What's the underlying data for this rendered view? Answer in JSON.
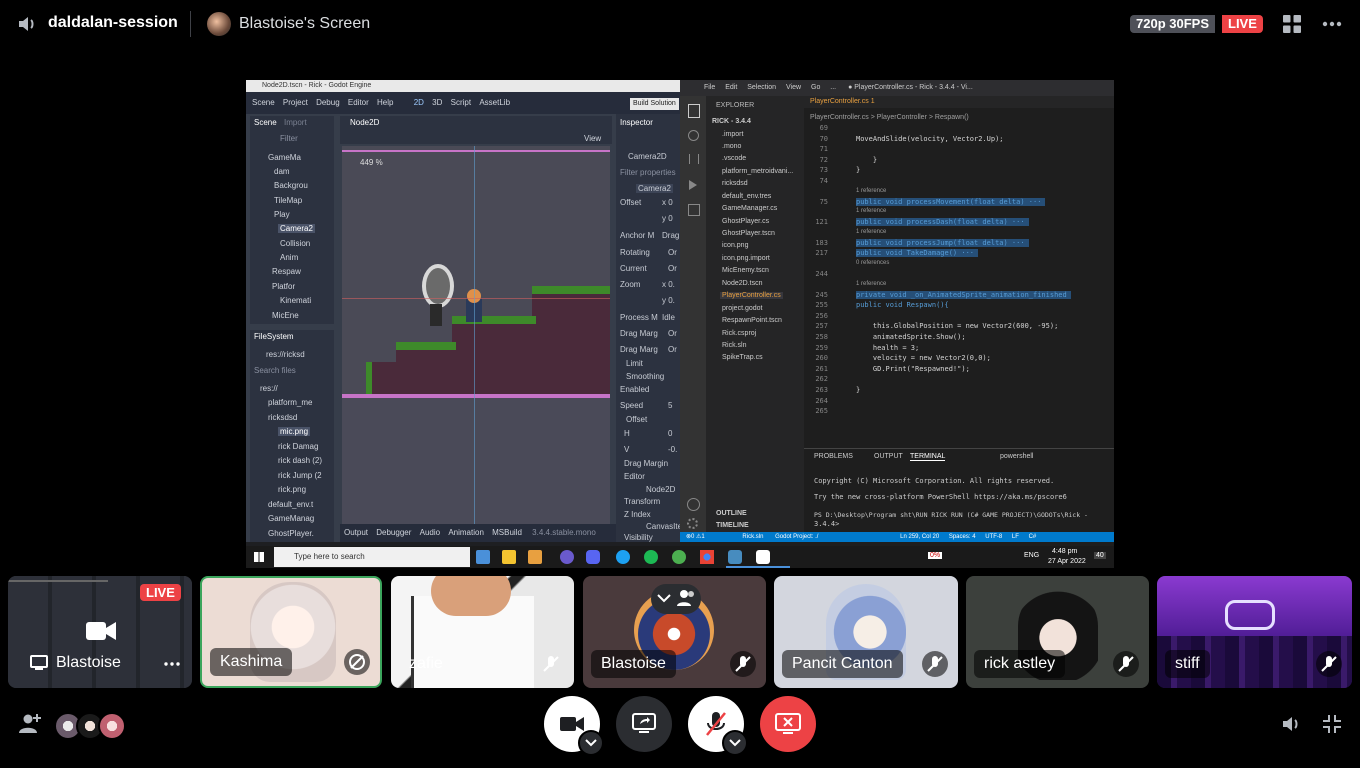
{
  "header": {
    "session_name": "daldalan-session",
    "screen_title": "Blastoise's Screen",
    "quality": "720p 30FPS",
    "live_badge": "LIVE"
  },
  "stream": {
    "godot": {
      "window_title": "Node2D.tscn - Rick - Godot Engine",
      "menu": [
        "Scene",
        "Project",
        "Debug",
        "Editor",
        "Help"
      ],
      "modes": [
        "2D",
        "3D",
        "Script",
        "AssetLib"
      ],
      "tooltip": "Build Solution",
      "scene_tab": "Scene",
      "import_tab": "Import",
      "viewport_tab": "Node2D",
      "zoom": "449 %",
      "view_label": "View",
      "filter_placeholder": "Filter",
      "scene_nodes": [
        "GameMa",
        "dam",
        "Backgrou",
        "TileMap",
        "Play",
        "Camera2",
        "Collision",
        "Anim",
        "Respaw",
        "Platfor",
        "Kinemati",
        "MicEne"
      ],
      "filesystem_tab": "FileSystem",
      "res_path": "res://ricksd",
      "search_files": "Search files",
      "files": [
        "res://",
        "platform_me",
        "ricksdsd",
        "mic.png",
        "rick Damag",
        "rick dash (2)",
        "rick Jump (2",
        "rick.png",
        "default_env.t",
        "GameManag",
        "GhostPlayer."
      ],
      "bottom_tabs": [
        "Output",
        "Debugger",
        "Audio",
        "Animation",
        "MSBuild"
      ],
      "version": "3.4.4.stable.mono",
      "inspector_tab": "Inspector",
      "inspector_node": "Camera2D",
      "filter_properties": "Filter properties",
      "inspector_class": "Camera2",
      "inspector_props": [
        "Offset",
        "Anchor M",
        "Rotating",
        "Current",
        "Zoom",
        "Process M",
        "Drag Marg",
        "Drag Marg",
        "Limit",
        "Smoothing",
        "Enabled",
        "Speed",
        "Offset",
        "H",
        "V",
        "Drag Margin",
        "Editor",
        "Node2D",
        "Transform",
        "Z Index",
        "CanvasIte",
        "Visibility"
      ],
      "inspector_values": [
        "x 0",
        "y 0",
        "Drag",
        "Or",
        "Or",
        "x 0.",
        "y 0.",
        "Idle",
        "Or",
        "Or",
        "5",
        "0",
        "-0."
      ]
    },
    "vscode": {
      "window_title": "● PlayerController.cs - Rick - 3.4.4 - Vi...",
      "menu": [
        "File",
        "Edit",
        "Selection",
        "View",
        "Go",
        "..."
      ],
      "explorer_title": "EXPLORER",
      "project_root": "RICK - 3.4.4",
      "files": [
        ".import",
        ".mono",
        ".vscode",
        "platform_metroidvani...",
        "ricksdsd",
        "default_env.tres",
        "GameManager.cs",
        "GhostPlayer.cs",
        "GhostPlayer.tscn",
        "icon.png",
        "icon.png.import",
        "MicEnemy.tscn",
        "Node2D.tscn",
        "PlayerController.cs",
        "project.godot",
        "RespawnPoint.tscn",
        "Rick.csproj",
        "Rick.sln",
        "SpikeTrap.cs"
      ],
      "outline": "OUTLINE",
      "timeline": "TIMELINE",
      "editor_tab": "PlayerController.cs 1",
      "breadcrumb": "PlayerController.cs > PlayerController > Respawn()",
      "code": [
        {
          "ln": "69",
          "text": ""
        },
        {
          "ln": "70",
          "text": "MoveAndSlide(velocity, Vector2.Up);"
        },
        {
          "ln": "71",
          "text": ""
        },
        {
          "ln": "72",
          "text": "    }"
        },
        {
          "ln": "73",
          "text": "}"
        },
        {
          "ln": "74",
          "text": ""
        },
        {
          "ln": "75",
          "text": "public void processMovement(float delta) ···"
        },
        {
          "ln": "121",
          "text": "public void processDash(float delta) ···"
        },
        {
          "ln": "183",
          "text": "public void processJump(float delta) ···"
        },
        {
          "ln": "217",
          "text": "public void TakeDamage() ···"
        },
        {
          "ln": "244",
          "text": ""
        },
        {
          "ln": "245",
          "text": "private void _on_AnimatedSprite_animation_finished"
        },
        {
          "ln": "255",
          "text": "public void Respawn(){"
        },
        {
          "ln": "256",
          "text": ""
        },
        {
          "ln": "257",
          "text": "    this.GlobalPosition = new Vector2(600, -95);"
        },
        {
          "ln": "258",
          "text": "    animatedSprite.Show();"
        },
        {
          "ln": "259",
          "text": "    health = 3;"
        },
        {
          "ln": "260",
          "text": "    velocity = new Vector2(0,0);"
        },
        {
          "ln": "261",
          "text": "    GD.Print(\"Respawned!\");"
        },
        {
          "ln": "262",
          "text": ""
        },
        {
          "ln": "263",
          "text": "}"
        },
        {
          "ln": "264",
          "text": ""
        },
        {
          "ln": "265",
          "text": ""
        }
      ],
      "refs": [
        "1 reference",
        "1 reference",
        "1 reference",
        "1 reference",
        "0 references",
        "1 reference"
      ],
      "terminal_tabs": [
        "PROBLEMS",
        "OUTPUT",
        "TERMINAL"
      ],
      "terminal_shell": "powershell",
      "terminal_lines": [
        "Copyright (C) Microsoft Corporation. All rights reserved.",
        "Try the new cross-platform PowerShell https://aka.ms/pscore6",
        "PS D:\\Desktop\\Program sht\\RUN RICK RUN (C# GAME PROJECT)\\GODOTs\\Rick -",
        " 3.4.4>"
      ],
      "status_left": "⊗0 ⚠1",
      "status_items": [
        "Rick.sln",
        "Godot Project: ./",
        "Ln 259, Col 20",
        "Spaces: 4",
        "UTF-8",
        "LF",
        "C#"
      ]
    },
    "taskbar": {
      "search_placeholder": "Type here to search",
      "battery": "0%",
      "lang": "ENG",
      "time": "4:48 pm",
      "date": "27 Apr 2022",
      "notif": "40"
    }
  },
  "tiles": [
    {
      "name": "Blastoise",
      "type": "screen",
      "badge": "LIVE"
    },
    {
      "name": "Kashima",
      "type": "active"
    },
    {
      "name": "zafie",
      "type": "camera"
    },
    {
      "name": "Blastoise",
      "type": "avatar"
    },
    {
      "name": "Pancit Canton",
      "type": "avatar"
    },
    {
      "name": "rick astley",
      "type": "avatar"
    },
    {
      "name": "stiff",
      "type": "avatar"
    }
  ],
  "colors": {
    "live_red": "#ed4245",
    "active_green": "#3ba55c",
    "vscode_blue": "#007acc"
  }
}
